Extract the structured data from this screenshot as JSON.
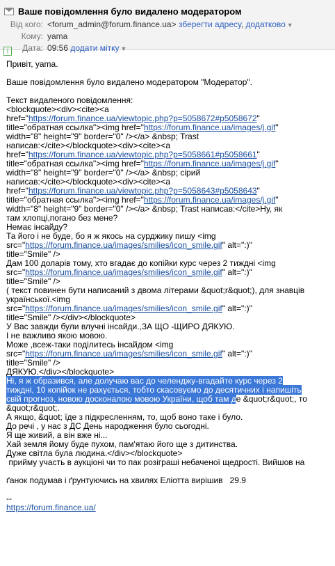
{
  "header": {
    "subject": "Ваше повідомлення було видалено модератором",
    "from_label": "Від кого:",
    "from_value": "<forum_admin@forum.finance.ua>",
    "save_address": "зберегти адресу",
    "additional": "додатково",
    "to_label": "Кому:",
    "to_value": "yama",
    "date_label": "Дата:",
    "date_value": "09:56",
    "add_tag": "додати мітку"
  },
  "body": {
    "greeting": "Привіт, yama.",
    "notice": "Ваше повідомлення було видалено модератором \"Модератор\".",
    "lines": [
      {
        "t": "Текст видаленого повідомлення:"
      },
      {
        "t": "<blockquote><div><cite><a"
      },
      {
        "t": "href=\"",
        "u": "https://forum.finance.ua/viewtopic.php?p=5058672#p5058672",
        "a": "\""
      },
      {
        "t": "title=\"обратная ссылка\"><img href=\"",
        "u": "https://forum.finance.ua/images/j.gif",
        "a": "\""
      },
      {
        "t": "width=\"8\" height=\"9\" border=\"0\" /></a> &nbsp; Trast"
      },
      {
        "t": "написав:</cite></blockquote><div><cite><a"
      },
      {
        "t": "href=\"",
        "u": "https://forum.finance.ua/viewtopic.php?p=5058661#p5058661",
        "a": "\""
      },
      {
        "t": "title=\"обратная ссылка\"><img href=\"",
        "u": "https://forum.finance.ua/images/j.gif",
        "a": "\""
      },
      {
        "t": "width=\"8\" height=\"9\" border=\"0\" /></a> &nbsp; сірий"
      },
      {
        "t": "написав:</cite></blockquote><div><cite><a"
      },
      {
        "t": "href=\"",
        "u": "https://forum.finance.ua/viewtopic.php?p=5058643#p5058643",
        "a": "\""
      },
      {
        "t": "title=\"обратная ссылка\"><img href=\"",
        "u": "https://forum.finance.ua/images/j.gif",
        "a": "\""
      },
      {
        "t": "width=\"8\" height=\"9\" border=\"0\" /></a> &nbsp; Trast написав:</cite>Ну, як"
      },
      {
        "t": "там хлопці,погано без мене?"
      },
      {
        "t": "Немає інсайду?"
      },
      {
        "t": "Та його і не буде, бо я ж якось на сурджику пишу <img"
      },
      {
        "t": "src=\"",
        "u": "https://forum.finance.ua/images/smilies/icon_smile.gif",
        "a": "\" alt=\":)\""
      },
      {
        "t": "title=\"Smile\" />"
      },
      {
        "t": "Дам 100 доларів тому, хто вгадає до копійки курс через 2 тиждні <img"
      },
      {
        "t": "src=\"",
        "u": "https://forum.finance.ua/images/smilies/icon_smile.gif",
        "a": "\" alt=\":)\""
      },
      {
        "t": "title=\"Smile\" />"
      },
      {
        "t": "( текст повинен бути написаний з двома літерами &quot;r&quot;), для знавців"
      },
      {
        "t": "української.<img"
      },
      {
        "t": "src=\"",
        "u": "https://forum.finance.ua/images/smilies/icon_smile.gif",
        "a": "\" alt=\":)\""
      },
      {
        "t": "title=\"Smile\" /></div></blockquote>"
      },
      {
        "t": "У Вас завжди були влучні інсайди.,ЗА ЩО -ЩИРО ДЯКУЮ."
      },
      {
        "t": "І не важливо якою мовою."
      },
      {
        "t": "Може ,всеж-таки поділитесь інсайдом <img"
      },
      {
        "t": "src=\"",
        "u": "https://forum.finance.ua/images/smilies/icon_smile.gif",
        "a": "\" alt=\":)\""
      },
      {
        "t": "title=\"Smile\" />"
      },
      {
        "t": "ДЯКУЮ.</div></blockquote>"
      }
    ],
    "selected_1": "Ні, я ж образився, але долучаю вас до челенджу-вгадайте курс через 2",
    "selected_2": "тиждні, 10 копійок не рахується, тобто скасовуємо до десятичних і напишіть",
    "selected_3a": "свій прогноз, новою досконалою мовою України, щоб там д",
    "selected_3b": "е &quot;r&quot;, то",
    "after_lines": [
      "&quot;r&quot;.",
      "А якщо, &quot; їде з підкресленням, то, щоб воно таке і було.",
      "До речі , у нас з ДС День народження було сьогодні.",
      "Я ще живий, а він вже ні...",
      "Хай земля йому буде пухом, пам'ятаю його ще з дитинства.",
      "Дуже світла була людина.</div></blockquote>",
      " прийму участь в аукціоні чи то пак розіграші небаченої щедрості. Вийшов на"
    ],
    "last_line": "ґанок подумав і ґрунтуючись на хвилях Еліотта вирішив   29.9",
    "sig_dash": "--",
    "sig_url": "https://forum.finance.ua/"
  }
}
